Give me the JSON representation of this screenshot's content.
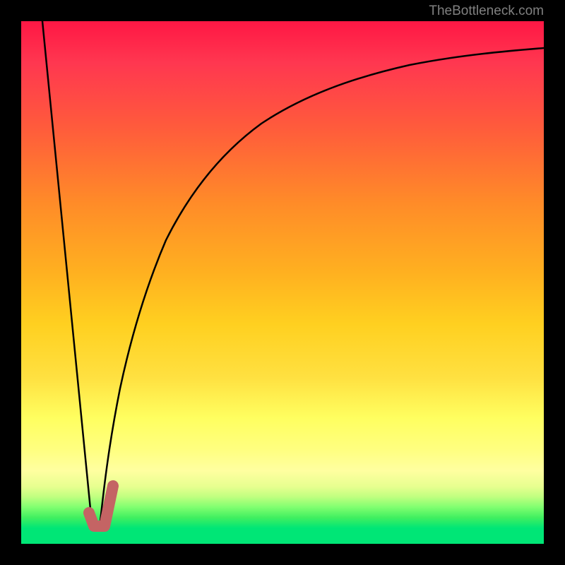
{
  "watermark": "TheBottleneck.com",
  "chart_data": {
    "type": "line",
    "title": "",
    "xlabel": "",
    "ylabel": "",
    "xlim": [
      0,
      100
    ],
    "ylim": [
      0,
      100
    ],
    "grid": false,
    "series": [
      {
        "name": "line1-descending",
        "color": "#000000",
        "width": 2,
        "points": [
          {
            "x": 4,
            "y": 0
          },
          {
            "x": 13.5,
            "y": 96
          }
        ]
      },
      {
        "name": "line2-curve",
        "color": "#000000",
        "width": 2,
        "points": [
          {
            "x": 15,
            "y": 97
          },
          {
            "x": 17,
            "y": 82
          },
          {
            "x": 20,
            "y": 67
          },
          {
            "x": 24,
            "y": 53
          },
          {
            "x": 29,
            "y": 41
          },
          {
            "x": 35,
            "y": 31
          },
          {
            "x": 42,
            "y": 24
          },
          {
            "x": 50,
            "y": 18
          },
          {
            "x": 60,
            "y": 14
          },
          {
            "x": 72,
            "y": 11
          },
          {
            "x": 85,
            "y": 9
          },
          {
            "x": 100,
            "y": 8
          }
        ]
      },
      {
        "name": "marker-j-shape",
        "color": "#cc6666",
        "width": 14,
        "points": [
          {
            "x": 13,
            "y": 94
          },
          {
            "x": 14,
            "y": 96.5
          },
          {
            "x": 16,
            "y": 96.5
          },
          {
            "x": 17.5,
            "y": 89
          }
        ]
      }
    ],
    "background_gradient": {
      "type": "vertical",
      "stops": [
        {
          "pos": 0,
          "color": "#ff1744"
        },
        {
          "pos": 50,
          "color": "#ffb020"
        },
        {
          "pos": 80,
          "color": "#ffff60"
        },
        {
          "pos": 100,
          "color": "#00e676"
        }
      ]
    }
  }
}
